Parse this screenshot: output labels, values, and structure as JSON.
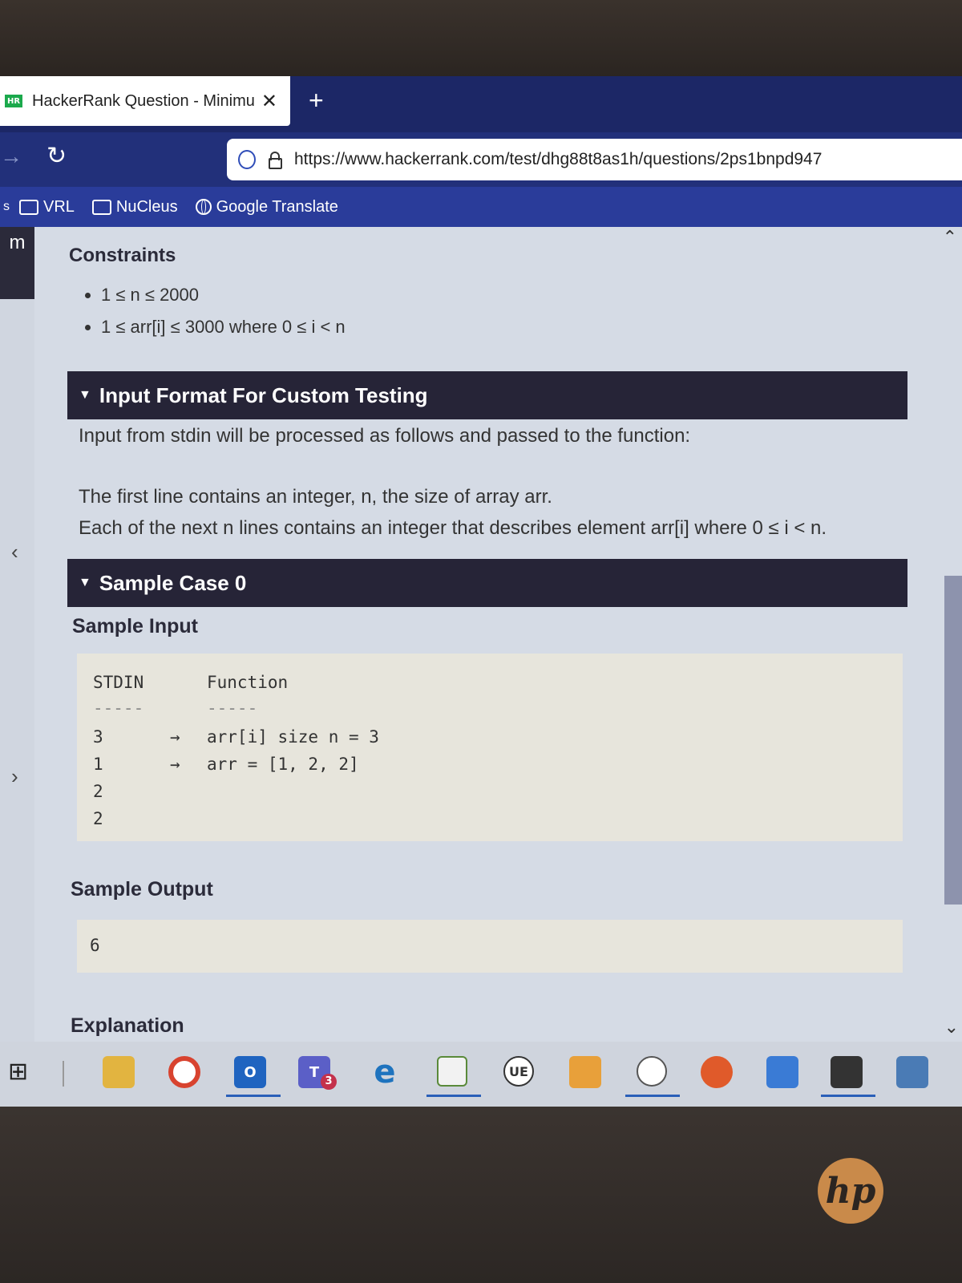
{
  "browser": {
    "tab_title": "HackerRank Question - Minimu",
    "tab_close": "✕",
    "new_tab": "+",
    "url": "https://www.hackerrank.com/test/dhg88t8as1h/questions/2ps1bnpd947",
    "bookmarks": [
      "VRL",
      "NuCleus",
      "Google Translate"
    ]
  },
  "sidebar": {
    "top_glyph": "m"
  },
  "content": {
    "constraints_title": "Constraints",
    "constraints": [
      "1 ≤ n ≤ 2000",
      "1 ≤ arr[i] ≤ 3000 where 0 ≤ i < n"
    ],
    "input_format_title": "Input Format For Custom Testing",
    "input_format_line1": "Input from stdin will be processed as follows and passed to the function:",
    "input_format_line2": "The first line contains an integer, n, the size of array arr.",
    "input_format_line3": "Each of the next n lines contains an integer that describes element arr[i] where 0 ≤ i < n.",
    "sample_case_title": "Sample Case 0",
    "sample_input_title": "Sample Input",
    "stdin_header": "STDIN",
    "function_header": "Function",
    "dashes": "-----",
    "stdin_lines": [
      "3",
      "1",
      "2",
      "2"
    ],
    "arrow": "→",
    "function_lines": [
      "arr[i] size n = 3",
      "arr = [1, 2, 2]"
    ],
    "sample_output_title": "Sample Output",
    "sample_output_value": "6",
    "explanation_title": "Explanation"
  },
  "taskbar": {
    "icons": [
      "task-view-icon",
      "file-explorer-icon",
      "chrome-icon",
      "outlook-icon",
      "teams-icon",
      "edge-icon",
      "editor-icon",
      "ue-icon",
      "mail-icon",
      "snip-icon",
      "office-icon",
      "network-icon",
      "terminal-icon",
      "remote-icon"
    ],
    "teams_badge": "3",
    "outlook_label": "O",
    "teams_label": "T",
    "ue_label": "UE"
  },
  "hp_logo": "hp"
}
